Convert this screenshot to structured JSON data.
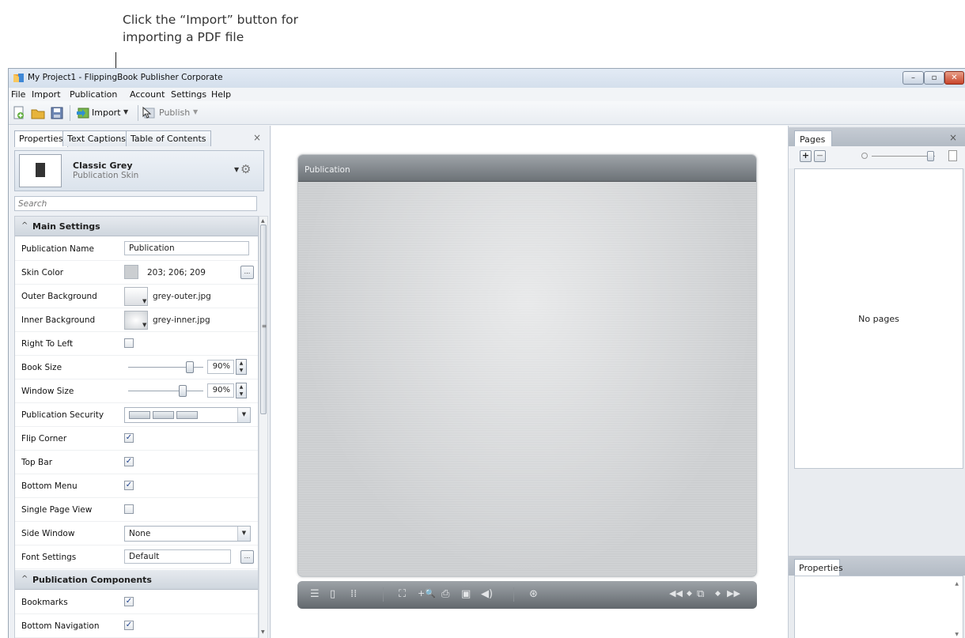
{
  "callout": {
    "line1": "Click the “Import” button for",
    "line2": "importing a PDF file"
  },
  "window": {
    "title": "My Project1 - FlippingBook Publisher Corporate",
    "controls": {
      "minimize": "–",
      "maximize": "▫",
      "close": "✕"
    }
  },
  "menu": [
    "File",
    "Import",
    "Publication",
    "Account",
    "Settings",
    "Help"
  ],
  "toolbar": {
    "import_label": "Import",
    "publish_label": "Publish",
    "dropdown_glyph": "▼"
  },
  "left_panel": {
    "tabs": [
      "Properties",
      "Text Captions",
      "Table of Contents"
    ],
    "close_glyph": "×",
    "skin": {
      "name": "Classic Grey",
      "subtitle": "Publication Skin"
    },
    "search_placeholder": "Search",
    "main_settings": {
      "header": "Main Settings",
      "chevron": "^",
      "publication_name": {
        "label": "Publication Name",
        "value": "Publication"
      },
      "skin_color": {
        "label": "Skin Color",
        "value": "203; 206; 209",
        "swatch": "#cbced1",
        "button": "..."
      },
      "outer_background": {
        "label": "Outer Background",
        "value": "grey-outer.jpg"
      },
      "inner_background": {
        "label": "Inner Background",
        "value": "grey-inner.jpg"
      },
      "right_to_left": {
        "label": "Right To Left",
        "checked": false
      },
      "book_size": {
        "label": "Book Size",
        "value": "90%",
        "level": 0.9
      },
      "window_size": {
        "label": "Window Size",
        "value": "90%",
        "level": 0.9
      },
      "publication_security": {
        "label": "Publication Security"
      },
      "flip_corner": {
        "label": "Flip Corner",
        "checked": true
      },
      "top_bar": {
        "label": "Top Bar",
        "checked": true
      },
      "bottom_menu": {
        "label": "Bottom Menu",
        "checked": true
      },
      "single_page_view": {
        "label": "Single Page View",
        "checked": false
      },
      "side_window": {
        "label": "Side Window",
        "value": "None"
      },
      "font_settings": {
        "label": "Font Settings",
        "value": "Default",
        "button": "..."
      }
    },
    "components": {
      "header": "Publication Components",
      "chevron": "^",
      "bookmarks": {
        "label": "Bookmarks",
        "checked": true
      },
      "bottom_navigation": {
        "label": "Bottom Navigation",
        "checked": true
      }
    }
  },
  "preview": {
    "header_title": "Publication"
  },
  "pages_panel": {
    "tab": "Pages",
    "close_glyph": "×",
    "empty_text": "No pages"
  },
  "properties_panel": {
    "tab": "Properties"
  },
  "colors": {
    "accent": "#1d3f8c",
    "skin_grey": "#cbced1",
    "close_red": "#c8442a"
  }
}
